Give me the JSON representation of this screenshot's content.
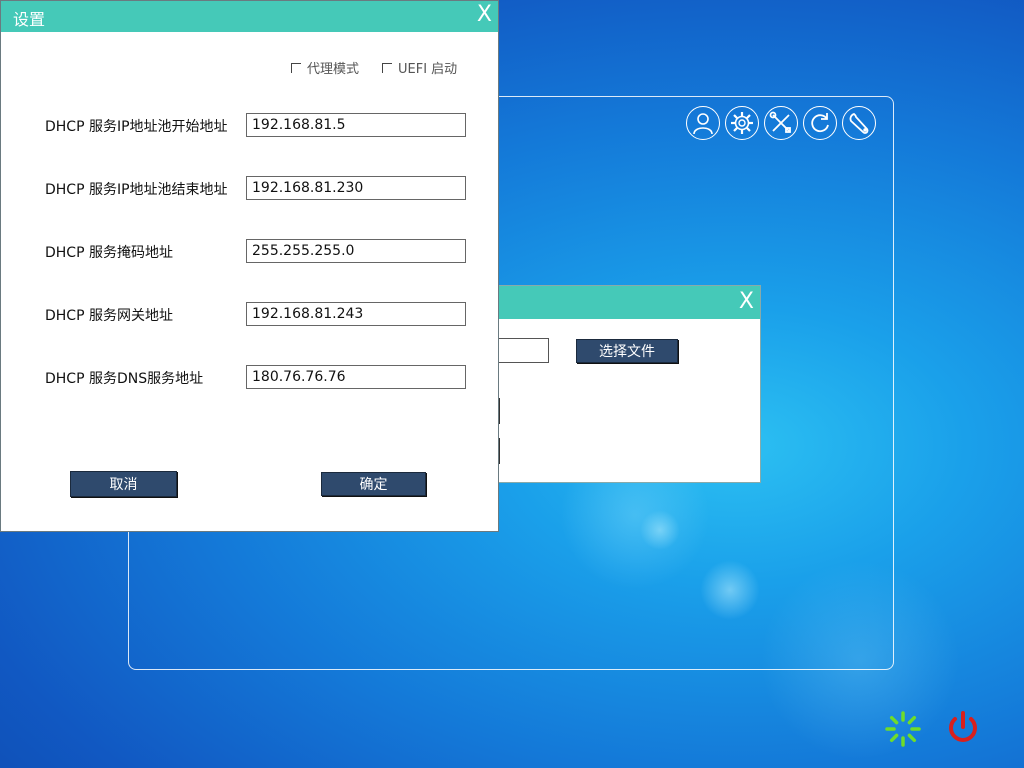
{
  "settings_dialog": {
    "title": "设置",
    "close_label": "X",
    "options": {
      "proxy_mode": {
        "label": "代理模式",
        "checked": false
      },
      "uefi_boot": {
        "label": "UEFI 启动",
        "checked": false
      }
    },
    "fields": [
      {
        "label": "DHCP 服务IP地址池开始地址",
        "value": "192.168.81.5"
      },
      {
        "label": "DHCP 服务IP地址池结束地址",
        "value": "192.168.81.230"
      },
      {
        "label": "DHCP 服务掩码地址",
        "value": "255.255.255.0"
      },
      {
        "label": "DHCP 服务网关地址",
        "value": "192.168.81.243"
      },
      {
        "label": "DHCP 服务DNS服务地址",
        "value": "180.76.76.76"
      }
    ],
    "cancel_label": "取消",
    "ok_label": "确定"
  },
  "file_dialog": {
    "close_label": "X",
    "select_file_label": "选择文件"
  },
  "toolbar": {
    "icons": [
      "user-icon",
      "gear-icon",
      "tools-icon",
      "refresh-icon",
      "wrench-icon"
    ]
  },
  "tray": {
    "icons": [
      "loading-spinner-icon",
      "power-icon"
    ]
  },
  "colors": {
    "title_bar": "#45c9b8",
    "button": "#2f4a6d",
    "spinner": "#6fdc2a",
    "power": "#d8201d"
  }
}
